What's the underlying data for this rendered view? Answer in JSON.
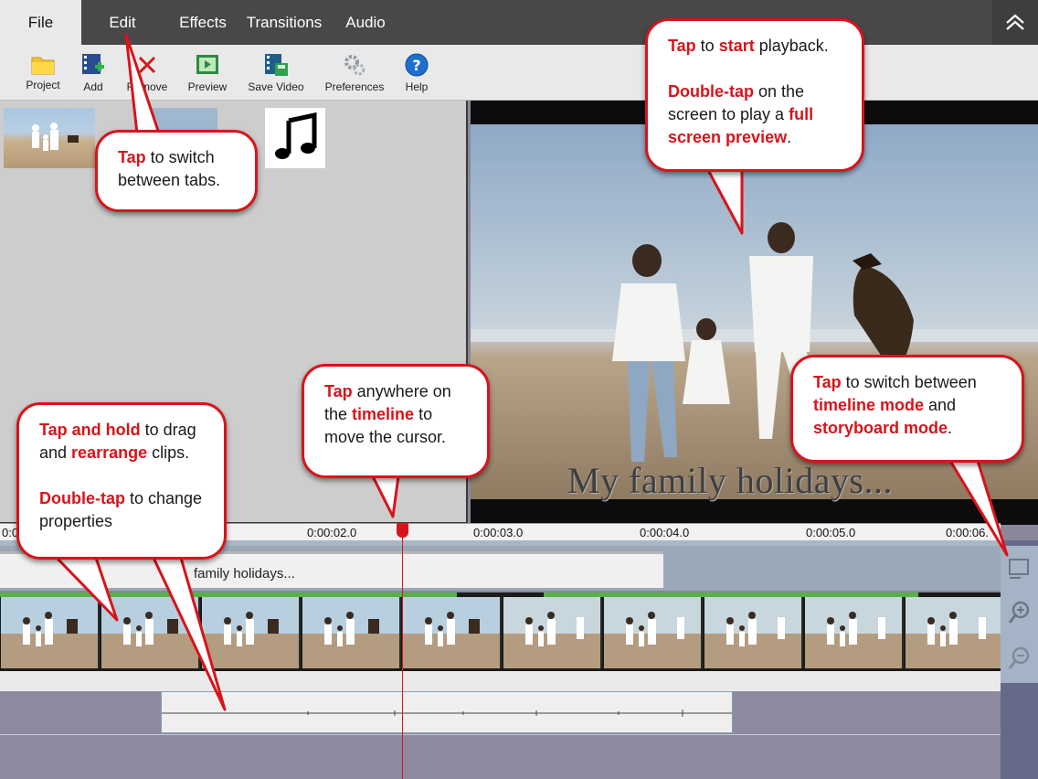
{
  "menu": {
    "tabs": [
      {
        "label": "File",
        "active": true
      },
      {
        "label": "Edit",
        "active": false
      },
      {
        "label": "Effects",
        "active": false
      },
      {
        "label": "Transitions",
        "active": false
      },
      {
        "label": "Audio",
        "active": false
      }
    ],
    "collapse_icon": "chevron-up-icon"
  },
  "toolbar": {
    "project_label": "Project",
    "add_label": "Add",
    "remove_label": "Remove",
    "preview_label": "Preview",
    "save_video_label": "Save Video",
    "preferences_label": "Preferences",
    "help_label": "Help"
  },
  "preview": {
    "title_overlay": "My family holidays..."
  },
  "timeline": {
    "ticks": [
      "0:0",
      "0:00:02.0",
      "0:00:03.0",
      "0:00:04.0",
      "0:00:05.0",
      "0:00:06."
    ],
    "text_clip_label": "family holidays..."
  },
  "callouts": {
    "tabs": {
      "b1": "Tap",
      "t1": " to switch between tabs."
    },
    "playback": {
      "b1": "Tap",
      "t1": " to ",
      "b2": "start",
      "t2": " playback.",
      "b3": "Double-tap",
      "t3": " on the screen to play a ",
      "b4": "full screen preview",
      "t4": "."
    },
    "timeline": {
      "b1": "Tap",
      "t1": " anywhere on the ",
      "b2": "timeline",
      "t2": " to move the cursor."
    },
    "mode": {
      "b1": "Tap",
      "t1": " to switch between ",
      "b2": "timeline mode",
      "t2": " and ",
      "b3": "storyboard mode",
      "t3": "."
    },
    "clips": {
      "b1": "Tap and hold",
      "t1": " to drag and ",
      "b2": "rearrange",
      "t2": " clips.",
      "b3": "Double-tap",
      "t3": " to change properties"
    }
  },
  "colors": {
    "accent_red": "#d8141b",
    "menu_bg": "#484848",
    "toolbar_bg": "#e9e9e9"
  }
}
